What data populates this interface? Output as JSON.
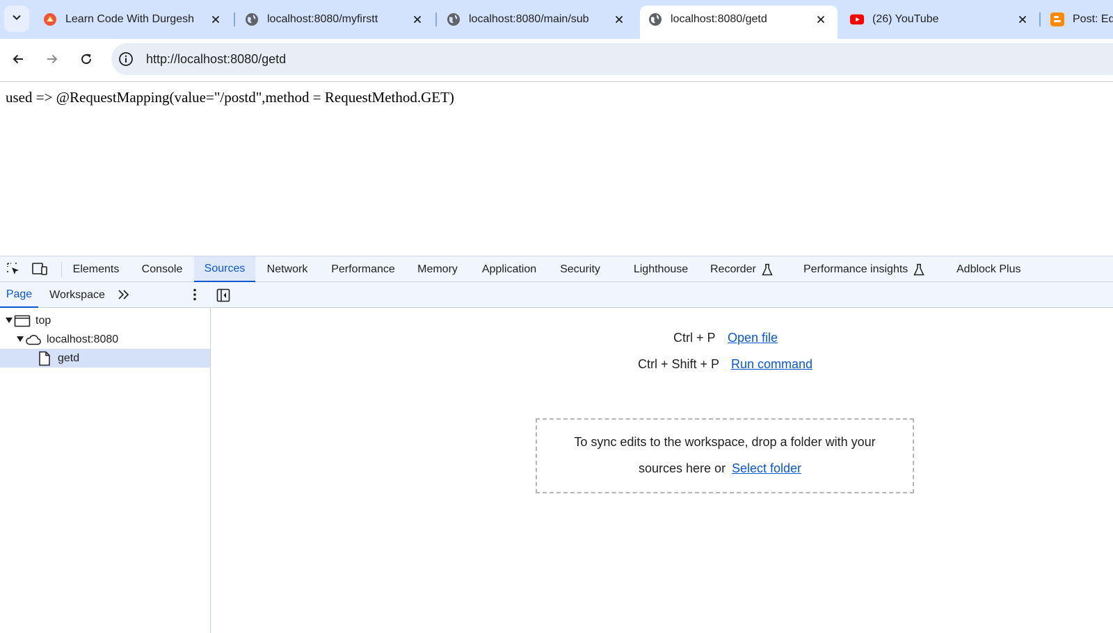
{
  "browser": {
    "tabs": [
      {
        "title": "Learn Code With Durgesh",
        "icon": "durgesh-favicon",
        "active": false
      },
      {
        "title": "localhost:8080/myfirstt",
        "icon": "globe-icon",
        "active": false
      },
      {
        "title": "localhost:8080/main/sub",
        "icon": "globe-icon",
        "active": false
      },
      {
        "title": "localhost:8080/getd",
        "icon": "globe-icon",
        "active": true
      },
      {
        "title": "(26) YouTube",
        "icon": "youtube-icon",
        "active": false
      },
      {
        "title": "Post: Ed",
        "icon": "blogger-icon",
        "active": false
      }
    ],
    "url": "http://localhost:8080/getd"
  },
  "page": {
    "text": "used => @RequestMapping(value=\"/postd\",method = RequestMethod.GET)"
  },
  "devtools": {
    "tabs": [
      "Elements",
      "Console",
      "Sources",
      "Network",
      "Performance",
      "Memory",
      "Application",
      "Security",
      "Lighthouse",
      "Recorder",
      "Performance insights",
      "Adblock Plus"
    ],
    "active_tab": "Sources",
    "sources": {
      "subtabs": [
        "Page",
        "Workspace"
      ],
      "active_subtab": "Page",
      "tree": [
        {
          "label": "top",
          "icon": "frame-icon",
          "expanded": true
        },
        {
          "label": "localhost:8080",
          "icon": "cloud-icon",
          "expanded": true
        },
        {
          "label": "getd",
          "icon": "file-icon",
          "selected": true
        }
      ],
      "shortcuts": [
        {
          "keys": "Ctrl + P",
          "action": "Open file"
        },
        {
          "keys": "Ctrl + Shift + P",
          "action": "Run command"
        }
      ],
      "dropzone": {
        "line1": "To sync edits to the workspace, drop a folder with your",
        "line2": "sources here or",
        "link": "Select folder"
      }
    }
  },
  "colors": {
    "tabstrip": "#d3e3fd",
    "accent": "#0b57d0",
    "youtube": "#ff0000",
    "blogger": "#ff8a00"
  }
}
